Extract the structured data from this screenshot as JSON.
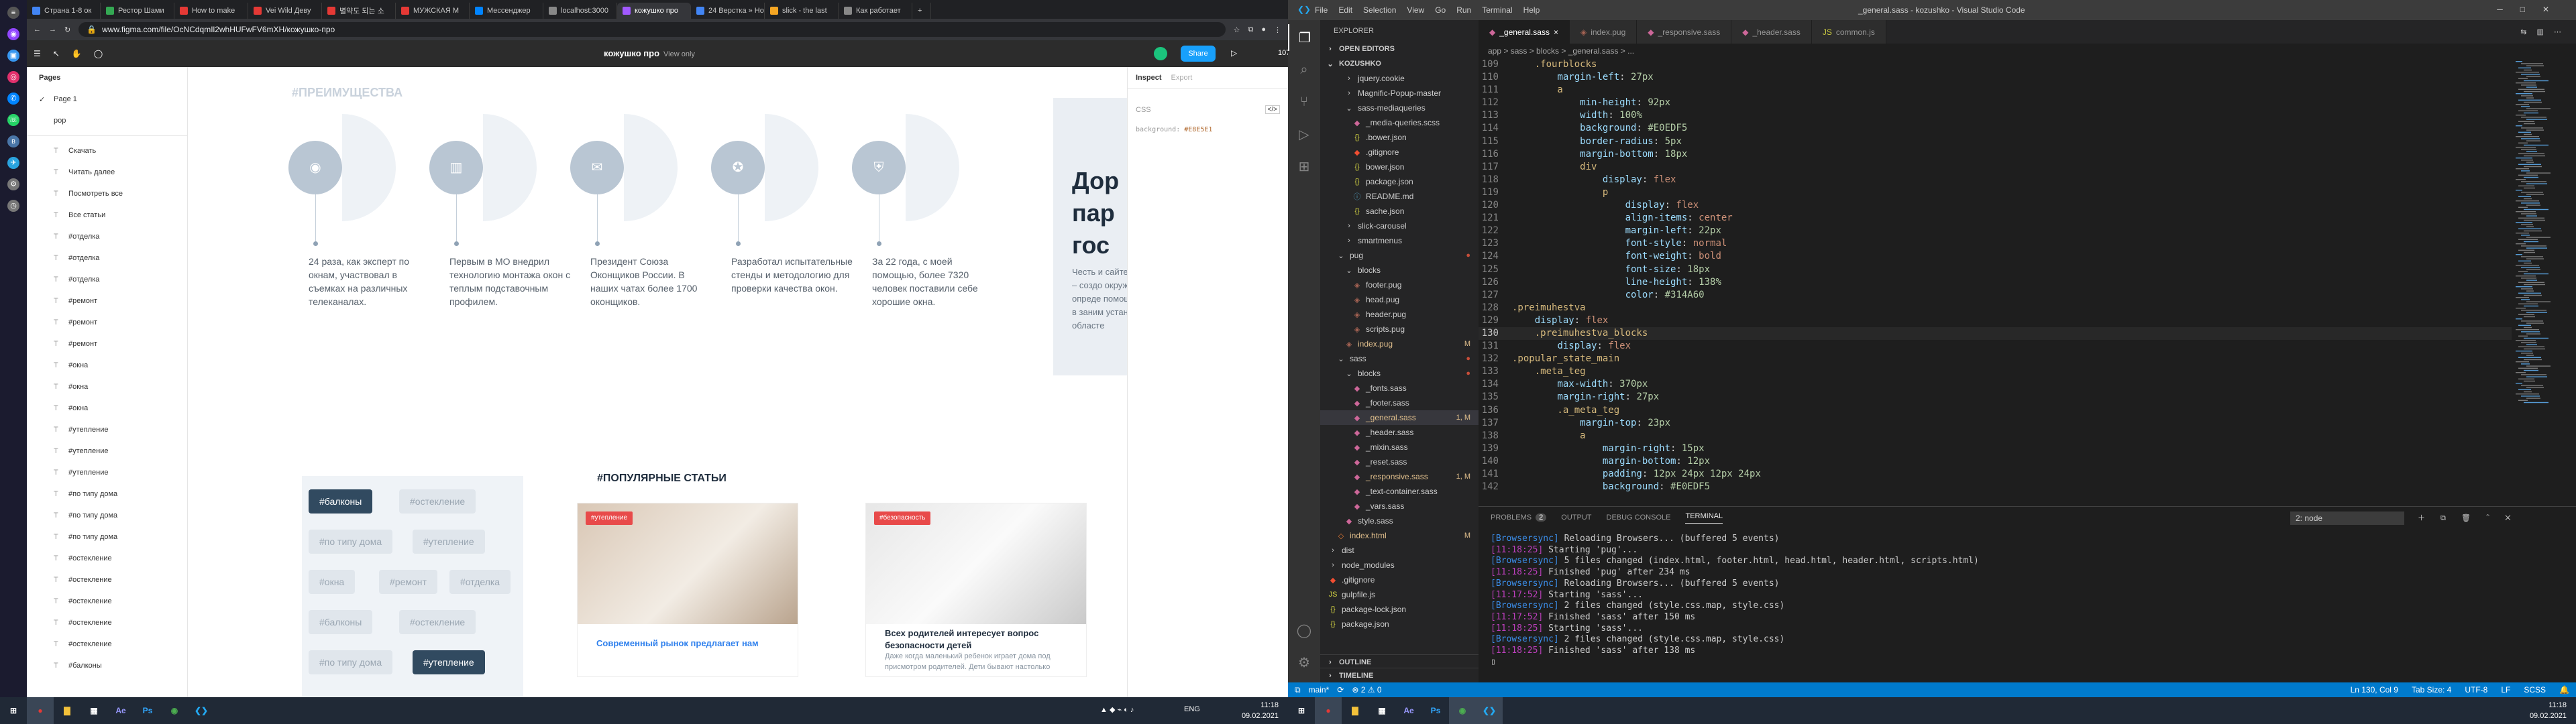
{
  "left_sidebar_icons": [
    "menu-icon",
    "user-icon",
    "twitch-icon",
    "instagram-icon",
    "messenger-icon",
    "whatsapp-icon",
    "vk-icon",
    "telegram-icon",
    "settings-icon",
    "time-icon"
  ],
  "chrome": {
    "tabs": [
      {
        "label": "Страна 1-8 ок",
        "color": "#4285f4"
      },
      {
        "label": "Рестор Шами",
        "color": "#34a853"
      },
      {
        "label": "How to make",
        "color": "#e53935"
      },
      {
        "label": "Vei Wild Деву",
        "color": "#e53935"
      },
      {
        "label": "별약도 되는 소",
        "color": "#e53935"
      },
      {
        "label": "МУЖСКАЯ М",
        "color": "#e53935"
      },
      {
        "label": "Мессенджер",
        "color": "#0084ff"
      },
      {
        "label": "localhost:3000",
        "color": "#888888"
      },
      {
        "label": "кожушко про",
        "color": "#a259ff"
      },
      {
        "label": "24 Верстка » Нос",
        "color": "#4285f4"
      },
      {
        "label": "slick - the last",
        "color": "#f5a623"
      },
      {
        "label": "Как работает",
        "color": "#888888"
      }
    ],
    "url": "www.figma.com/file/OcNCdqmIl2whHUFwFV6mXH/кожушко-про"
  },
  "figma": {
    "title": "кожушко про",
    "view_mode": "View only",
    "share": "Share",
    "zoom": "107%",
    "pages_header": "Pages",
    "pages": [
      "Page 1",
      "pop"
    ],
    "layers": [
      "Скачать",
      "Читать далее",
      "Посмотреть все",
      "Все статьи",
      "#отделка",
      "#отделка",
      "#отделка",
      "#ремонт",
      "#ремонт",
      "#ремонт",
      "#окна",
      "#окна",
      "#окна",
      "#утепление",
      "#утепление",
      "#утепление",
      "#по типу дома",
      "#по типу дома",
      "#по типу дома",
      "#остекление",
      "#остекление",
      "#остекление",
      "#остекление",
      "#остекление",
      "#балконы"
    ],
    "inspect_tab": "Inspect",
    "export_tab": "Export",
    "css_label": "CSS",
    "bg_prop": "background:",
    "bg_val": "#E8E5E1",
    "prem_title": "#ПРЕИМУЩЕСТВА",
    "features": [
      {
        "icon": "camera-icon",
        "text": "24 раза, как эксперт по окнам, участвовал в съемках на различных телеканалах."
      },
      {
        "icon": "window-icon",
        "text": "Первым в МО внедрил технологию монтажа окон с теплым подставочным профилем."
      },
      {
        "icon": "gift-icon",
        "text": "Президент Союза Оконщиков России. В наших чатах более 1700 оконщиков."
      },
      {
        "icon": "badge-icon",
        "text": "Разработал испытательные стенды и методологию для проверки качества окон."
      },
      {
        "icon": "shield-icon",
        "text": "За 22 года, с моей помощью, более 7320 человек поставили себе хорошие окна."
      }
    ],
    "right_heading": "Дор пар гос",
    "right_text": "Честь и сайте. Р – создо окружа опреде помощь в заним установ областе",
    "popular_title": "#ПОПУЛЯРНЫЕ СТАТЬИ",
    "tags": [
      "#балконы",
      "#остекление",
      "#по типу дома",
      "#утепление",
      "#окна",
      "#ремонт",
      "#отделка",
      "#балконы",
      "#остекление",
      "#по типу дома",
      "#утепление"
    ],
    "cards": [
      {
        "badge": "#утепление",
        "title": "Современный рынок предлагает нам",
        "text": ""
      },
      {
        "badge": "#безопасность",
        "title": "Всех родителей интересует вопрос безопасности детей",
        "text": "Даже когда маленький ребенок играет дома под присмотром родителей. Дети бывают настолько"
      }
    ]
  },
  "taskbar_left": {
    "time": "11:18",
    "date": "09.02.2021",
    "lang": "ENG",
    "apps": [
      "start",
      "search",
      "explorer",
      "files",
      "ae",
      "ps",
      "vscode"
    ]
  },
  "vscode": {
    "menu": [
      "File",
      "Edit",
      "Selection",
      "View",
      "Go",
      "Run",
      "Terminal",
      "Help"
    ],
    "window_title": "_general.sass - kozushko - Visual Studio Code",
    "explorer_title": "EXPLORER",
    "open_editors": "OPEN EDITORS",
    "project": "KOZUSHKO",
    "tree": [
      {
        "name": "jquery.cookie",
        "indent": 2,
        "kind": "folder-closed",
        "status": ""
      },
      {
        "name": "Magnific-Popup-master",
        "indent": 2,
        "kind": "folder-closed",
        "status": ""
      },
      {
        "name": "sass-mediaqueries",
        "indent": 2,
        "kind": "folder-open",
        "status": ""
      },
      {
        "name": "_media-queries.scss",
        "indent": 3,
        "kind": "sass",
        "status": ""
      },
      {
        "name": ".bower.json",
        "indent": 3,
        "kind": "json",
        "status": ""
      },
      {
        "name": ".gitignore",
        "indent": 3,
        "kind": "git",
        "status": ""
      },
      {
        "name": "bower.json",
        "indent": 3,
        "kind": "json",
        "status": ""
      },
      {
        "name": "package.json",
        "indent": 3,
        "kind": "json",
        "status": ""
      },
      {
        "name": "README.md",
        "indent": 3,
        "kind": "md",
        "status": ""
      },
      {
        "name": "sache.json",
        "indent": 3,
        "kind": "json",
        "status": ""
      },
      {
        "name": "slick-carousel",
        "indent": 2,
        "kind": "folder-closed",
        "status": ""
      },
      {
        "name": "smartmenus",
        "indent": 2,
        "kind": "folder-closed",
        "status": ""
      },
      {
        "name": "pug",
        "indent": 1,
        "kind": "folder-open",
        "status": "●"
      },
      {
        "name": "blocks",
        "indent": 2,
        "kind": "folder-open",
        "status": ""
      },
      {
        "name": "footer.pug",
        "indent": 3,
        "kind": "pug",
        "status": ""
      },
      {
        "name": "head.pug",
        "indent": 3,
        "kind": "pug",
        "status": ""
      },
      {
        "name": "header.pug",
        "indent": 3,
        "kind": "pug",
        "status": ""
      },
      {
        "name": "scripts.pug",
        "indent": 3,
        "kind": "pug",
        "status": ""
      },
      {
        "name": "index.pug",
        "indent": 2,
        "kind": "pug",
        "status": "M"
      },
      {
        "name": "sass",
        "indent": 1,
        "kind": "folder-open",
        "status": "●"
      },
      {
        "name": "blocks",
        "indent": 2,
        "kind": "folder-open",
        "status": "●"
      },
      {
        "name": "_fonts.sass",
        "indent": 3,
        "kind": "sass",
        "status": ""
      },
      {
        "name": "_footer.sass",
        "indent": 3,
        "kind": "sass",
        "status": ""
      },
      {
        "name": "_general.sass",
        "indent": 3,
        "kind": "sass",
        "status": "1, M",
        "selected": true
      },
      {
        "name": "_header.sass",
        "indent": 3,
        "kind": "sass",
        "status": ""
      },
      {
        "name": "_mixin.sass",
        "indent": 3,
        "kind": "sass",
        "status": ""
      },
      {
        "name": "_reset.sass",
        "indent": 3,
        "kind": "sass",
        "status": ""
      },
      {
        "name": "_responsive.sass",
        "indent": 3,
        "kind": "sass",
        "status": "1, M"
      },
      {
        "name": "_text-container.sass",
        "indent": 3,
        "kind": "sass",
        "status": ""
      },
      {
        "name": "_vars.sass",
        "indent": 3,
        "kind": "sass",
        "status": ""
      },
      {
        "name": "style.sass",
        "indent": 2,
        "kind": "sass",
        "status": ""
      },
      {
        "name": "index.html",
        "indent": 1,
        "kind": "html",
        "status": "M"
      },
      {
        "name": "dist",
        "indent": 0,
        "kind": "folder-closed",
        "status": ""
      },
      {
        "name": "node_modules",
        "indent": 0,
        "kind": "folder-closed",
        "status": ""
      },
      {
        "name": ".gitignore",
        "indent": 0,
        "kind": "git",
        "status": ""
      },
      {
        "name": "gulpfile.js",
        "indent": 0,
        "kind": "js",
        "status": ""
      },
      {
        "name": "package-lock.json",
        "indent": 0,
        "kind": "json",
        "status": ""
      },
      {
        "name": "package.json",
        "indent": 0,
        "kind": "json",
        "status": ""
      }
    ],
    "outline": "OUTLINE",
    "timeline": "TIMELINE",
    "tabs": [
      {
        "label": "_general.sass",
        "icon": "sass",
        "active": true
      },
      {
        "label": "index.pug",
        "icon": "pug",
        "active": false
      },
      {
        "label": "_responsive.sass",
        "icon": "sass",
        "active": false
      },
      {
        "label": "_header.sass",
        "icon": "sass",
        "active": false
      },
      {
        "label": "common.js",
        "icon": "js",
        "active": false
      }
    ],
    "breadcrumb": "app > sass > blocks > _general.sass > ...",
    "code": [
      {
        "n": "109",
        "t": "    .fourblocks",
        "c": "sel"
      },
      {
        "n": "110",
        "t": "        margin-left: 27px",
        "c": "pv"
      },
      {
        "n": "111",
        "t": "        a",
        "c": "sel"
      },
      {
        "n": "112",
        "t": "            min-height: 92px",
        "c": "pv"
      },
      {
        "n": "113",
        "t": "            width: 100%",
        "c": "pv"
      },
      {
        "n": "114",
        "t": "            background: #E0EDF5",
        "c": "pv"
      },
      {
        "n": "115",
        "t": "            border-radius: 5px",
        "c": "pv"
      },
      {
        "n": "116",
        "t": "            margin-bottom: 18px",
        "c": "pv"
      },
      {
        "n": "117",
        "t": "            div",
        "c": "sel"
      },
      {
        "n": "118",
        "t": "                display: flex",
        "c": "pv"
      },
      {
        "n": "119",
        "t": "                p",
        "c": "sel"
      },
      {
        "n": "120",
        "t": "                    display: flex",
        "c": "pv"
      },
      {
        "n": "121",
        "t": "                    align-items: center",
        "c": "pv"
      },
      {
        "n": "122",
        "t": "                    margin-left: 22px",
        "c": "pv"
      },
      {
        "n": "123",
        "t": "                    font-style: normal",
        "c": "pv"
      },
      {
        "n": "124",
        "t": "                    font-weight: bold",
        "c": "pv"
      },
      {
        "n": "125",
        "t": "                    font-size: 18px",
        "c": "pv"
      },
      {
        "n": "126",
        "t": "                    line-height: 138%",
        "c": "pv"
      },
      {
        "n": "127",
        "t": "                    color: #314A60",
        "c": "pv"
      },
      {
        "n": "128",
        "t": ".preimuhestva",
        "c": "sel"
      },
      {
        "n": "129",
        "t": "    display: flex",
        "c": "pv"
      },
      {
        "n": "130",
        "t": "    .preimuhestva_blocks",
        "c": "sel",
        "cur": true
      },
      {
        "n": "131",
        "t": "        display: flex",
        "c": "pv"
      },
      {
        "n": "132",
        "t": ".popular_state_main",
        "c": "sel"
      },
      {
        "n": "133",
        "t": "    .meta_teg",
        "c": "sel"
      },
      {
        "n": "134",
        "t": "        max-width: 370px",
        "c": "pv"
      },
      {
        "n": "135",
        "t": "        margin-right: 27px",
        "c": "pv"
      },
      {
        "n": "136",
        "t": "        .a_meta_teg",
        "c": "sel"
      },
      {
        "n": "137",
        "t": "            margin-top: 23px",
        "c": "pv"
      },
      {
        "n": "138",
        "t": "            a",
        "c": "sel"
      },
      {
        "n": "139",
        "t": "                margin-right: 15px",
        "c": "pv"
      },
      {
        "n": "140",
        "t": "                margin-bottom: 12px",
        "c": "pv"
      },
      {
        "n": "141",
        "t": "                padding: 12px 24px 12px 24px",
        "c": "pv"
      },
      {
        "n": "142",
        "t": "                background: #E0EDF5",
        "c": "pv"
      }
    ],
    "panel_tabs": [
      "PROBLEMS",
      "OUTPUT",
      "DEBUG CONSOLE",
      "TERMINAL"
    ],
    "problems_count": "2",
    "terminal_select": "2: node",
    "terminal": [
      {
        "time": "[Browsersync]",
        "msg": " Reloading Browsers... (buffered 5 events)"
      },
      {
        "time": "[11:18:25]",
        "msg": " Starting 'pug'..."
      },
      {
        "time": "[Browsersync]",
        "msg": " 5 files changed (index.html, footer.html, head.html, header.html, scripts.html)"
      },
      {
        "time": "[11:18:25]",
        "msg": " Finished 'pug' after 234 ms"
      },
      {
        "time": "[Browsersync]",
        "msg": " Reloading Browsers... (buffered 5 events)"
      },
      {
        "time": "[11:17:52]",
        "msg": " Starting 'sass'..."
      },
      {
        "time": "[Browsersync]",
        "msg": " 2 files changed (style.css.map, style.css)"
      },
      {
        "time": "[11:17:52]",
        "msg": " Finished 'sass' after 150 ms"
      },
      {
        "time": "[11:18:25]",
        "msg": " Starting 'sass'..."
      },
      {
        "time": "[Browsersync]",
        "msg": " 2 files changed (style.css.map, style.css)"
      },
      {
        "time": "[11:18:25]",
        "msg": " Finished 'sass' after 138 ms"
      }
    ],
    "status": {
      "branch": "main*",
      "sync": "⟳",
      "errors": "⊗ 2 ⚠ 0",
      "position": "Ln 130, Col 9",
      "spaces": "Tab Size: 4",
      "encoding": "UTF-8",
      "eol": "LF",
      "lang": "SCSS"
    }
  },
  "taskbar_right": {
    "time": "11:18",
    "date": "09.02.2021"
  }
}
